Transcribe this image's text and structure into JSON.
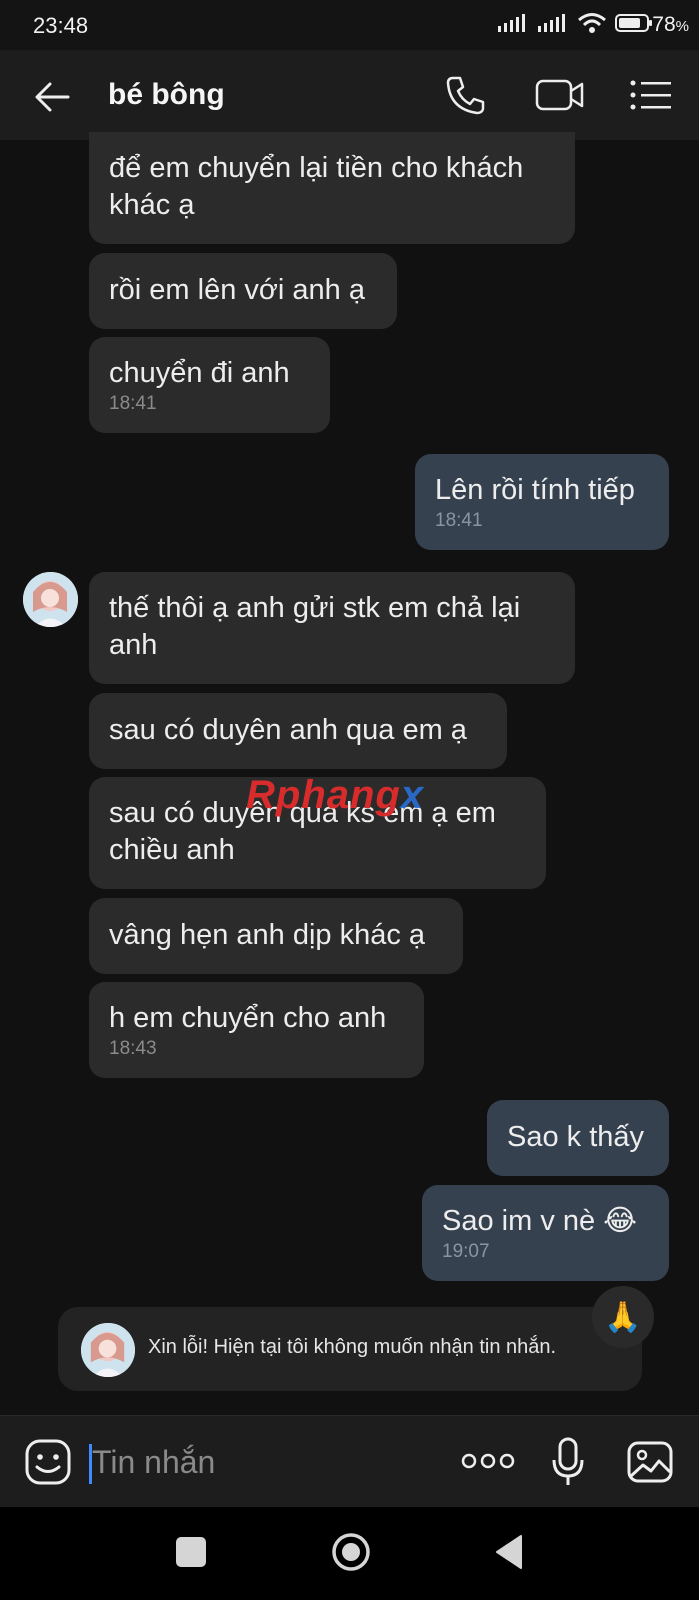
{
  "status_bar": {
    "time": "23:48",
    "battery": "78",
    "battery_suffix": "%"
  },
  "header": {
    "contact_name": "bé bông"
  },
  "messages": [
    {
      "text": "để em chuyển lại tiền cho khách\nkhác ạ",
      "time": ""
    },
    {
      "text": "rồi em lên với anh ạ",
      "time": ""
    },
    {
      "text": "chuyển đi anh",
      "time": "18:41"
    },
    {
      "text": "Lên rồi tính tiếp",
      "time": "18:41"
    },
    {
      "text": "thế thôi ạ anh gửi stk em chả lại\nanh",
      "time": ""
    },
    {
      "text": "sau có duyên anh qua em ạ",
      "time": ""
    },
    {
      "text": "sau có duyên qua ks em ạ em\nchiều anh",
      "time": ""
    },
    {
      "text": "vâng hẹn anh dịp khác ạ",
      "time": ""
    },
    {
      "text": "h em chuyển cho anh",
      "time": "18:43"
    },
    {
      "text": "Sao k thấy",
      "time": ""
    },
    {
      "text": "Sao im v nè 😂",
      "time": "19:07"
    }
  ],
  "watermark": {
    "part1": "Rphang",
    "part2": "x"
  },
  "auto_reply": {
    "text": "Xin lỗi! Hiện tại tôi không muốn nhận tin nhắn."
  },
  "reaction": {
    "emoji": "🙏"
  },
  "input": {
    "placeholder": "Tin nhắn"
  },
  "icons": {
    "back": "arrow-left-icon",
    "call": "phone-icon",
    "video": "video-camera-icon",
    "menu": "list-menu-icon",
    "emoji": "sticker-face-icon",
    "more": "more-dots-icon",
    "mic": "microphone-icon",
    "image": "image-icon"
  },
  "colors": {
    "background": "#111111",
    "incoming_bubble": "#2b2b2b",
    "outgoing_bubble": "#364150",
    "accent": "#3d8bff"
  }
}
